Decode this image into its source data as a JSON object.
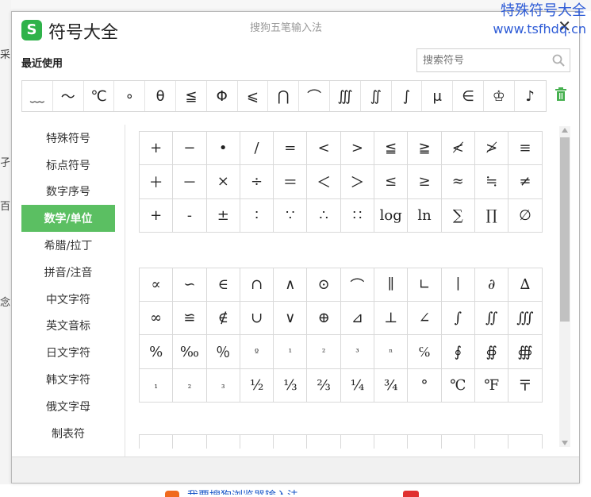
{
  "background": {
    "fragments": [
      "孑",
      "百",
      "念",
      "采"
    ],
    "bottom_text": "我要搜狗浏览器输入法"
  },
  "watermark": {
    "line1": "特殊符号大全",
    "line2": "www.tsfhdq.cn"
  },
  "window": {
    "logo": "S",
    "title": "符号大全",
    "ime_name": "搜狗五笔输入法",
    "close": "✕"
  },
  "recent": {
    "label": "最近使用",
    "symbols": [
      "﹏",
      "～",
      "℃",
      "∘",
      "θ",
      "≦",
      "Φ",
      "⩽",
      "⋂",
      "⌒",
      "∭",
      "∬",
      "∫",
      "μ",
      "∈",
      "♔",
      "♪"
    ]
  },
  "search": {
    "placeholder": "搜索符号"
  },
  "sidebar": {
    "items": [
      "特殊符号",
      "标点符号",
      "数字序号",
      "数学/单位",
      "希腊/拉丁",
      "拼音/注音",
      "中文字符",
      "英文音标",
      "日文字符",
      "韩文字符",
      "俄文字母",
      "制表符"
    ],
    "active_index": 3
  },
  "grid1": [
    "+",
    "−",
    "•",
    "/",
    "=",
    "<",
    ">",
    "≦",
    "≧",
    "≮",
    "≯",
    "≡",
    "＋",
    "－",
    "×",
    "÷",
    "＝",
    "＜",
    "＞",
    "≤",
    "≥",
    "≈",
    "≒",
    "≠",
    "+",
    "-",
    "±",
    "∶",
    "∵",
    "∴",
    "∷",
    "log",
    "ln",
    "∑",
    "∏",
    "∅"
  ],
  "grid2": [
    "∝",
    "∽",
    "∈",
    "∩",
    "∧",
    "⊙",
    "⌒",
    "∥",
    "∟",
    "∣",
    "∂",
    "∆",
    "∞",
    "≌",
    "∉",
    "∪",
    "∨",
    "⊕",
    "⊿",
    "⊥",
    "∠",
    "∫",
    "∬",
    "∭",
    "%",
    "‰",
    "％",
    "º",
    "¹",
    "²",
    "³",
    "ⁿ",
    "℅",
    "∮",
    "∯",
    "∰",
    "₁",
    "₂",
    "₃",
    "½",
    "⅓",
    "⅔",
    "¼",
    "¾",
    "°",
    "℃",
    "℉",
    "〒"
  ],
  "grid3": [
    "",
    "",
    "",
    "",
    "",
    "",
    "",
    "",
    "",
    "",
    "",
    ""
  ]
}
